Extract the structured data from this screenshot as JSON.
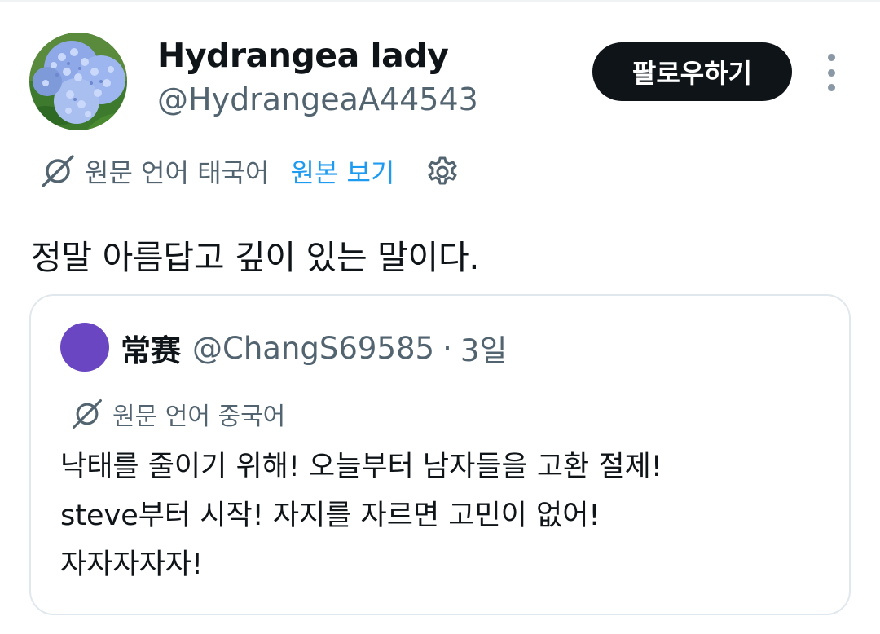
{
  "tweet": {
    "author": {
      "display_name": "Hydrangea lady",
      "handle": "@HydrangeaA44543"
    },
    "follow_label": "팔로우하기",
    "translation": {
      "label": "원문 언어 태국어",
      "show_original_label": "원본 보기"
    },
    "text": "정말 아름답고 깊이 있는 말이다."
  },
  "quote": {
    "author": {
      "display_name": "常赛",
      "handle": "@ChangS69585",
      "separator": "·",
      "time": "3일"
    },
    "avatar_color": "#6a46c2",
    "translation": {
      "label": "원문 언어 중국어"
    },
    "lines": [
      "낙태를 줄이기 위해! 오늘부터 남자들을 고환 절제!",
      "steve부터 시작! 자지를 자르면 고민이 없어!",
      "자자자자자!"
    ]
  },
  "colors": {
    "link": "#1d9bf0",
    "secondary_text": "#536471",
    "follow_button": "#0f1419"
  },
  "icons": [
    "avatar-hydrangea",
    "translate-icon",
    "gear-icon",
    "more-icon"
  ]
}
